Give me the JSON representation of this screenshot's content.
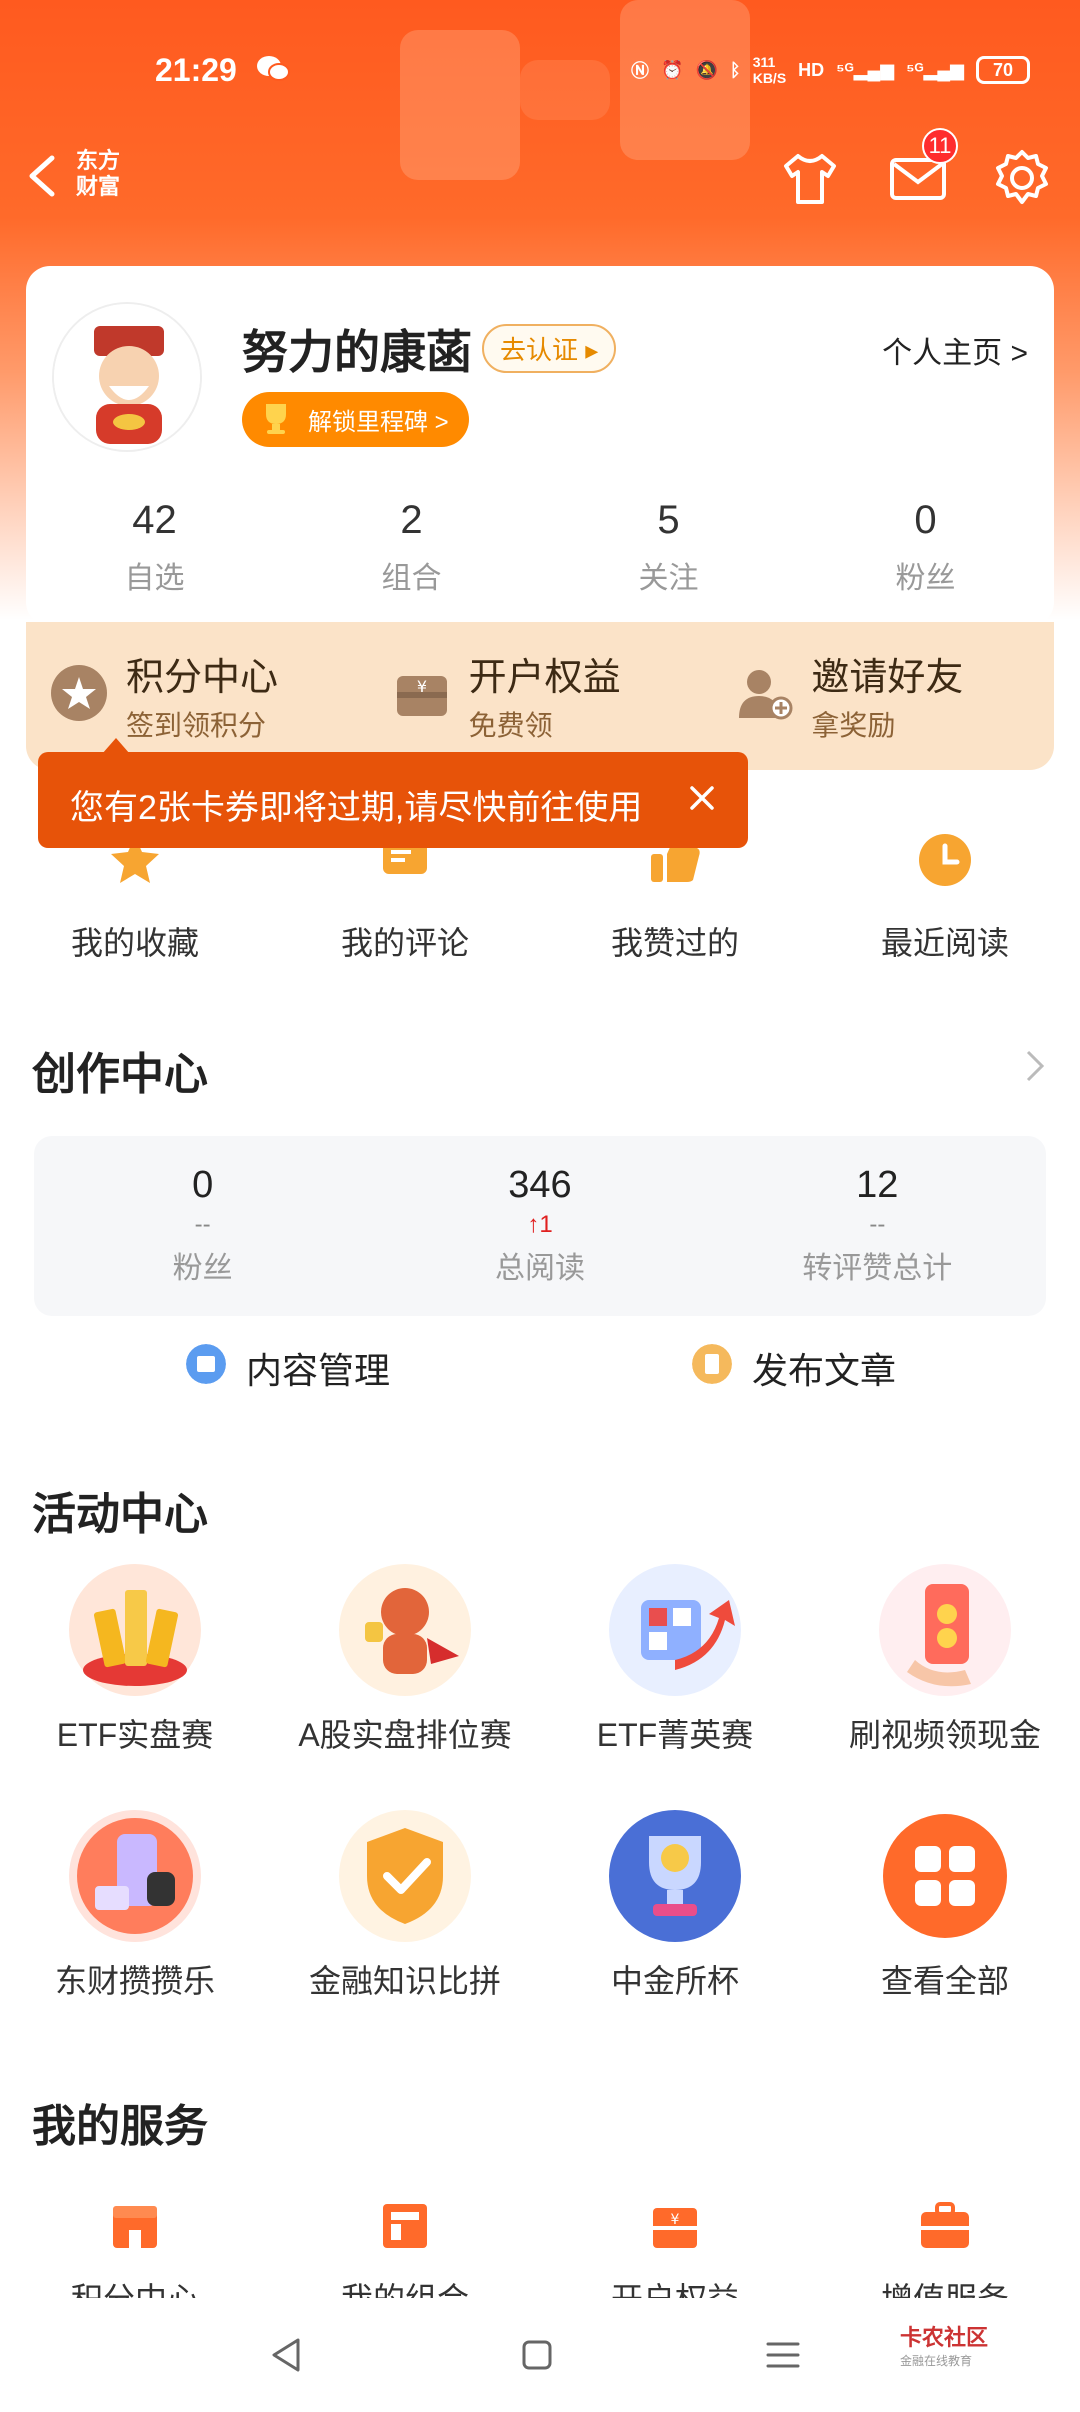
{
  "status_bar": {
    "time": "21:29",
    "net_speed": "311\nKB/S",
    "battery": "70"
  },
  "nav": {
    "logo_line1": "东方",
    "logo_line2": "财富",
    "mail_badge": "11"
  },
  "profile": {
    "username": "努力的康菡",
    "verify_label": "去认证 ▸",
    "milestone_label": "解锁里程碑 >",
    "homepage_label": "个人主页 >",
    "stats": [
      {
        "num": "42",
        "label": "自选"
      },
      {
        "num": "2",
        "label": "组合"
      },
      {
        "num": "5",
        "label": "关注"
      },
      {
        "num": "0",
        "label": "粉丝"
      }
    ]
  },
  "benefits": [
    {
      "title": "积分中心",
      "sub": "签到领积分"
    },
    {
      "title": "开户权益",
      "sub": "免费领"
    },
    {
      "title": "邀请好友",
      "sub": "拿奖励"
    }
  ],
  "toast": {
    "text": "您有2张卡券即将过期,请尽快前往使用"
  },
  "quick_links": [
    {
      "label": "我的收藏"
    },
    {
      "label": "我的评论"
    },
    {
      "label": "我赞过的"
    },
    {
      "label": "最近阅读"
    }
  ],
  "creator": {
    "title": "创作中心",
    "stats": [
      {
        "num": "0",
        "delta": "--",
        "label": "粉丝"
      },
      {
        "num": "346",
        "delta": "↑1",
        "label": "总阅读"
      },
      {
        "num": "12",
        "delta": "--",
        "label": "转评赞总计"
      }
    ],
    "content_manage": "内容管理",
    "publish": "发布文章"
  },
  "activity": {
    "title": "活动中心",
    "row1": [
      {
        "label": "ETF实盘赛"
      },
      {
        "label": "A股实盘排位赛"
      },
      {
        "label": "ETF菁英赛"
      },
      {
        "label": "刷视频领现金"
      }
    ],
    "row2": [
      {
        "label": "东财攒攒乐"
      },
      {
        "label": "金融知识比拼"
      },
      {
        "label": "中金所杯"
      },
      {
        "label": "查看全部"
      }
    ]
  },
  "services": {
    "title": "我的服务",
    "items": [
      {
        "label": "积分中心"
      },
      {
        "label": "我的组合"
      },
      {
        "label": "开户权益"
      },
      {
        "label": "增值服务"
      }
    ]
  },
  "watermark": {
    "line1": "卡农社区",
    "line2": "金融在线教育"
  },
  "colors": {
    "accent": "#ff5a1f",
    "toast": "#e75309",
    "benefit_bg": "#fbe3c8"
  }
}
